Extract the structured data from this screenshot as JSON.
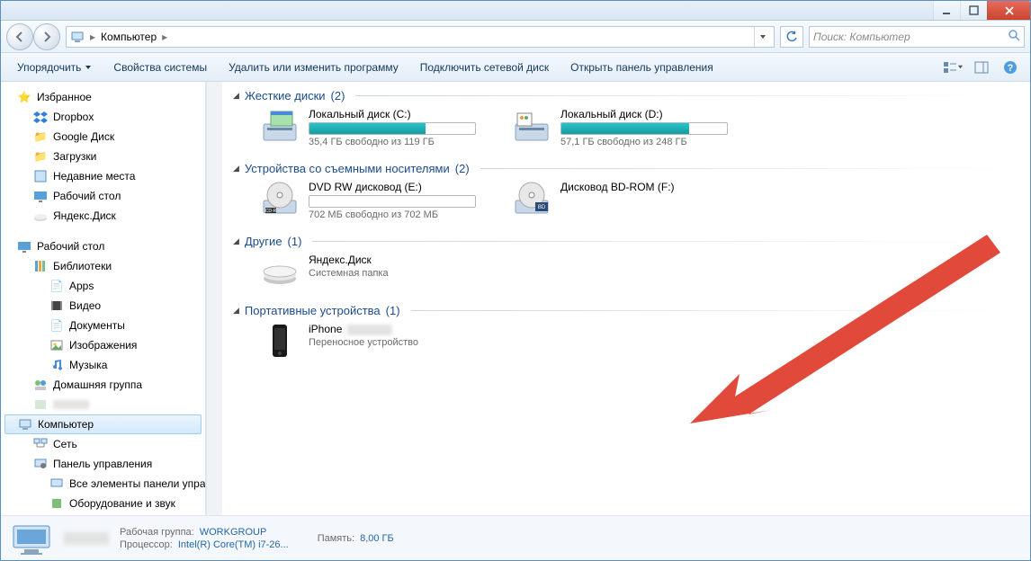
{
  "breadcrumb": {
    "root": "Компьютер"
  },
  "search": {
    "placeholder": "Поиск: Компьютер"
  },
  "toolbar": {
    "organize": "Упорядочить",
    "properties": "Свойства системы",
    "uninstall": "Удалить или изменить программу",
    "mapdrive": "Подключить сетевой диск",
    "controlpanel": "Открыть панель управления"
  },
  "sidebar": {
    "favorites": "Избранное",
    "fav_items": [
      "Dropbox",
      "Google Диск",
      "Загрузки",
      "Недавние места",
      "Рабочий стол",
      "Яндекс.Диск"
    ],
    "desktop": "Рабочий стол",
    "libraries": "Библиотеки",
    "lib_items": [
      "Apps",
      "Видео",
      "Документы",
      "Изображения",
      "Музыка"
    ],
    "homegroup": "Домашняя группа",
    "computer": "Компьютер",
    "network": "Сеть",
    "controlpanel": "Панель управления",
    "cp_items": [
      "Все элементы панели управле",
      "Оборудование и звук"
    ]
  },
  "sections": {
    "hdd": {
      "title": "Жесткие диски",
      "count": "(2)"
    },
    "removable": {
      "title": "Устройства со съемными носителями",
      "count": "(2)"
    },
    "other": {
      "title": "Другие",
      "count": "(1)"
    },
    "portable": {
      "title": "Портативные устройства",
      "count": "(1)"
    }
  },
  "drives": {
    "c": {
      "name": "Локальный диск (C:)",
      "status": "35,4 ГБ свободно из 119 ГБ",
      "fill": 70
    },
    "d": {
      "name": "Локальный диск (D:)",
      "status": "57,1 ГБ свободно из 248 ГБ",
      "fill": 77
    },
    "e": {
      "name": "DVD RW дисковод (E:)",
      "status": "702 МБ свободно из 702 МБ",
      "fill": 0
    },
    "f": {
      "name": "Дисковод BD-ROM (F:)"
    },
    "yandex": {
      "name": "Яндекс.Диск",
      "status": "Системная папка"
    },
    "iphone": {
      "name": "iPhone",
      "status": "Переносное устройство"
    }
  },
  "statusbar": {
    "workgroup_k": "Рабочая группа:",
    "workgroup_v": "WORKGROUP",
    "cpu_k": "Процессор:",
    "cpu_v": "Intel(R) Core(TM) i7-26...",
    "mem_k": "Память:",
    "mem_v": "8,00 ГБ"
  }
}
